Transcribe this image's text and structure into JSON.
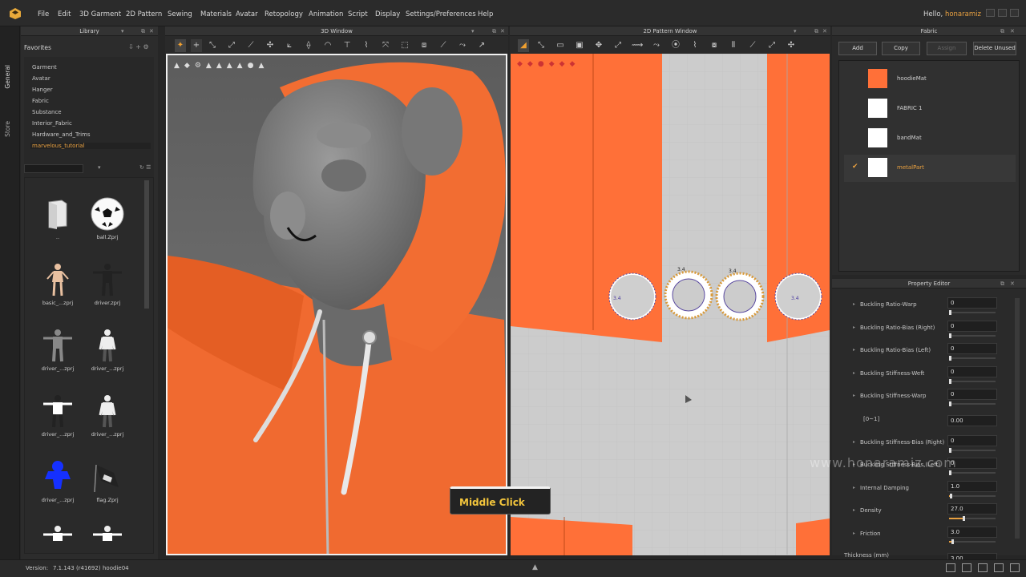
{
  "menu": [
    "File",
    "Edit",
    "3D Garment",
    "2D Pattern",
    "Sewing",
    "Materials",
    "Avatar",
    "Retopology",
    "Animation",
    "Script",
    "Display",
    "Settings/Preferences",
    "Help"
  ],
  "user": {
    "greeting": "Hello,",
    "name": "honaramiz"
  },
  "side_tabs": [
    "General",
    "Store"
  ],
  "library": {
    "title": "Library",
    "favorites_label": "Favorites",
    "favorites": [
      "Garment",
      "Avatar",
      "Hanger",
      "Fabric",
      "Substance",
      "Interior_Fabric",
      "Hardware_and_Trims",
      "marvelous_tutorial"
    ],
    "items": [
      {
        "label": "..",
        "icon": "folder-icon"
      },
      {
        "label": "ball.Zprj",
        "icon": "soccer-ball-icon"
      },
      {
        "label": "basic_...zprj",
        "icon": "avatar-female-icon"
      },
      {
        "label": "driver.zprj",
        "icon": "avatar-dark-icon"
      },
      {
        "label": "driver_...zprj",
        "icon": "avatar-grey-icon"
      },
      {
        "label": "driver_...zprj",
        "icon": "avatar-white-icon"
      },
      {
        "label": "driver_...zprj",
        "icon": "avatar-white-tpose-icon"
      },
      {
        "label": "driver_...zprj",
        "icon": "avatar-white-standing-icon"
      },
      {
        "label": "driver_...zprj",
        "icon": "avatar-blue-icon"
      },
      {
        "label": "flag.Zprj",
        "icon": "flag-icon"
      }
    ]
  },
  "win3d": {
    "title": "3D Window"
  },
  "win2d": {
    "title": "2D Pattern Window"
  },
  "fabric": {
    "title": "Fabric",
    "buttons": [
      "Add",
      "Copy",
      "Assign",
      "Delete Unused"
    ],
    "items": [
      {
        "name": "hoodieMat",
        "color": "#ff7038",
        "selected": false
      },
      {
        "name": "FABRIC 1",
        "color": "#ffffff",
        "selected": false
      },
      {
        "name": "bandMat",
        "color": "#ffffff",
        "selected": false
      },
      {
        "name": "metalPart",
        "color": "#ffffff",
        "selected": true
      }
    ]
  },
  "property_editor": {
    "title": "Property Editor",
    "rows": [
      {
        "label": "Buckling Ratio-Warp",
        "value": "0",
        "slider": 0
      },
      {
        "label": "Buckling Ratio-Bias (Right)",
        "value": "0",
        "slider": 0
      },
      {
        "label": "Buckling Ratio-Bias (Left)",
        "value": "0",
        "slider": 0
      },
      {
        "label": "Buckling Stiffness-Weft",
        "value": "0",
        "slider": 0
      },
      {
        "label": "Buckling Stiffness-Warp",
        "value": "0",
        "slider": 0
      },
      {
        "label": "[0~1]",
        "value": "0.00",
        "slider": null
      },
      {
        "label": "Buckling Stiffness-Bias (Right)",
        "value": "0",
        "slider": 0
      },
      {
        "label": "Buckling Stiffness-Bias (Left)",
        "value": "0",
        "slider": 0
      },
      {
        "label": "Internal Damping",
        "value": "1.0",
        "slider": 0.02
      },
      {
        "label": "Density",
        "value": "27.0",
        "slider": 0.3
      },
      {
        "label": "Friction",
        "value": "3.0",
        "slider": 0.05
      },
      {
        "label": "Thickness (mm)",
        "value": "3.00",
        "slider": null
      }
    ]
  },
  "status": {
    "version_label": "Version:",
    "version": "7.1.143 (r41692)",
    "file": "hoodie04"
  },
  "tooltip": "Middle Click",
  "watermark": "www.honaramiz.com",
  "pattern_label": "3.4"
}
